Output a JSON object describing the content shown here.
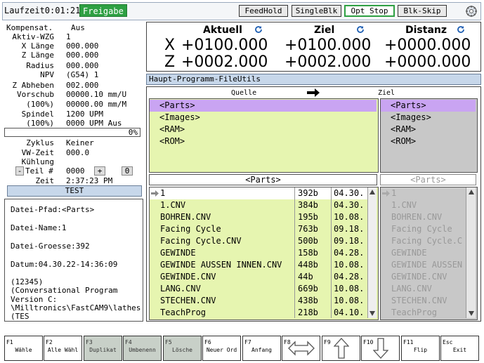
{
  "topbar": {
    "runtime": "Laufzeit0:01:21",
    "badge": "Freigabe",
    "buttons": [
      "FeedHold",
      "SingleBlk",
      "Opt Stop",
      "Blk-Skip"
    ]
  },
  "status": {
    "kompensat_label": "Kompensat.",
    "kompensat_value": "Aus",
    "aktiv_wzg_label": "Aktiv-WZG",
    "aktiv_wzg_value": "1",
    "x_laenge_label": "X Länge",
    "x_laenge_value": "000.000",
    "z_laenge_label": "Z Länge",
    "z_laenge_value": "000.000",
    "radius_label": "Radius",
    "radius_value": "000.000",
    "npv_label": "NPV",
    "npv_value": "(G54) 1",
    "z_abheben_label": "Z Abheben",
    "z_abheben_value": "002.000",
    "vorschub_label": "Vorschub",
    "vorschub_value": "00000.10 mm/U",
    "vorschub_pct_label": "(100%)",
    "vorschub_pct_value": "00000.00 mm/M",
    "spindel_label": "Spindel",
    "spindel_value": "1200 UPM",
    "spindel_pct_label": "(100%)",
    "spindel_pct_value": "0000 UPM Aus",
    "progress_text": "0%",
    "progress_value": 0,
    "zyklus_label": "Zyklus",
    "zyklus_value": "Keiner",
    "vw_zeit_label": "VW-Zeit",
    "vw_zeit_value": "000.0",
    "kuehlung_label": "Kühlung",
    "teil_label": "Teil #",
    "teil_value": "0000",
    "teil_minus": "-",
    "teil_plus": "+",
    "teil_extra": "0",
    "zeit_label": "Zeit",
    "zeit_value": "2:37:23 PM",
    "test_label": "TEST"
  },
  "fileinfo": {
    "pfad": "Datei-Pfad:<Parts>",
    "name": "Datei-Name:1",
    "groesse": "Datei-Groesse:392",
    "datum": "Datum:04.30.22-14:36:09",
    "content": [
      "(12345)",
      "(Conversational Program",
      "Version C:",
      "\\Milltronics\\FastCAM9\\lathes",
      "(TES"
    ]
  },
  "position": {
    "headers": [
      "Aktuell",
      "Ziel",
      "Distanz"
    ],
    "x_label": "X",
    "z_label": "Z",
    "x": [
      "+0100.000",
      "+0100.000",
      "+0000.000"
    ],
    "z": [
      "+0002.000",
      "+0002.000",
      "+0000.000"
    ]
  },
  "fileutils": {
    "title": "Haupt-Programm-FileUtils",
    "source_label": "Quelle",
    "target_label": "Ziel",
    "source_devices": [
      "<Parts>",
      "<Images>",
      "<RAM>",
      "<ROM>"
    ],
    "target_devices": [
      "<Parts>",
      "<Images>",
      "<RAM>",
      "<ROM>"
    ],
    "source_folder": "<Parts>",
    "target_folder": "<Parts>",
    "files": [
      {
        "name": "1",
        "size": "392b",
        "date": "04.30..."
      },
      {
        "name": "1.CNV",
        "size": "384b",
        "date": "04.30..."
      },
      {
        "name": "BOHREN.CNV",
        "size": "195b",
        "date": "10.08..."
      },
      {
        "name": "Facing Cycle",
        "size": "763b",
        "date": "09.18..."
      },
      {
        "name": "Facing Cycle.CNV",
        "size": "500b",
        "date": "09.18..."
      },
      {
        "name": "GEWINDE",
        "size": "158b",
        "date": "04.28..."
      },
      {
        "name": "GEWINDE AUSSEN INNEN.CNV",
        "size": "448b",
        "date": "10.08..."
      },
      {
        "name": "GEWINDE.CNV",
        "size": "44b",
        "date": "04.28..."
      },
      {
        "name": "LANG.CNV",
        "size": "669b",
        "date": "10.08..."
      },
      {
        "name": "STECHEN.CNV",
        "size": "438b",
        "date": "10.08..."
      },
      {
        "name": "TeachProg",
        "size": "218b",
        "date": "04.10..."
      }
    ],
    "target_files": [
      "1",
      "1.CNV",
      "BOHREN.CNV",
      "Facing Cycle",
      "Facing Cycle.C",
      "GEWINDE",
      "GEWINDE AUSSEN",
      "GEWINDE.CNV",
      "LANG.CNV",
      "STECHEN.CNV",
      "TeachProg"
    ]
  },
  "fkeys": [
    {
      "key": "F1",
      "label": "Wähle"
    },
    {
      "key": "F2",
      "label": "Alle Wähl"
    },
    {
      "key": "F3",
      "label": "Duplikat"
    },
    {
      "key": "F4",
      "label": "Umbenenn"
    },
    {
      "key": "F5",
      "label": "Lösche"
    },
    {
      "key": "F6",
      "label": "Neuer Ord"
    },
    {
      "key": "F7",
      "label": "Anfang"
    },
    {
      "key": "F8",
      "label": ""
    },
    {
      "key": "F9",
      "label": ""
    },
    {
      "key": "F10",
      "label": ""
    },
    {
      "key": "F11",
      "label": "Flip"
    },
    {
      "key": "Esc",
      "label": "Exit"
    }
  ],
  "colors": {
    "badge_green": "#2ea043",
    "title_blue": "#c7d7ea",
    "list_green": "#e6f5b0",
    "selected_purple": "#c9a4f2",
    "disabled_grey": "#c8c8c8"
  }
}
